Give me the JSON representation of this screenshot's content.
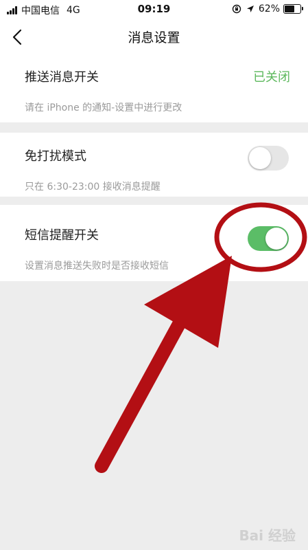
{
  "status_bar": {
    "carrier": "中国电信",
    "network": "4G",
    "time": "09:19",
    "battery": "62%",
    "battery_level": 0.62,
    "icons": [
      "signal-icon",
      "lock-rotation-icon",
      "location-arrow-icon",
      "battery-icon"
    ]
  },
  "header": {
    "title": "消息设置",
    "back_icon": "chevron-left-icon"
  },
  "settings": {
    "push": {
      "title": "推送消息开关",
      "status": "已关闭",
      "description": "请在 iPhone 的通知-设置中进行更改"
    },
    "dnd": {
      "title": "免打扰模式",
      "enabled": false,
      "description": "只在 6:30-23:00 接收消息提醒"
    },
    "sms": {
      "title": "短信提醒开关",
      "enabled": true,
      "description": "设置消息推送失败时是否接收短信"
    }
  },
  "annotation": {
    "color": "#b30f14",
    "shapes": [
      "highlight-ellipse",
      "pointer-arrow"
    ]
  },
  "watermark": {
    "text": "Bai 经验"
  },
  "colors": {
    "toggle_on": "#5bbd67",
    "toggle_off": "#e6e6e6",
    "status_green": "#5cb85c",
    "background": "#ededed"
  }
}
